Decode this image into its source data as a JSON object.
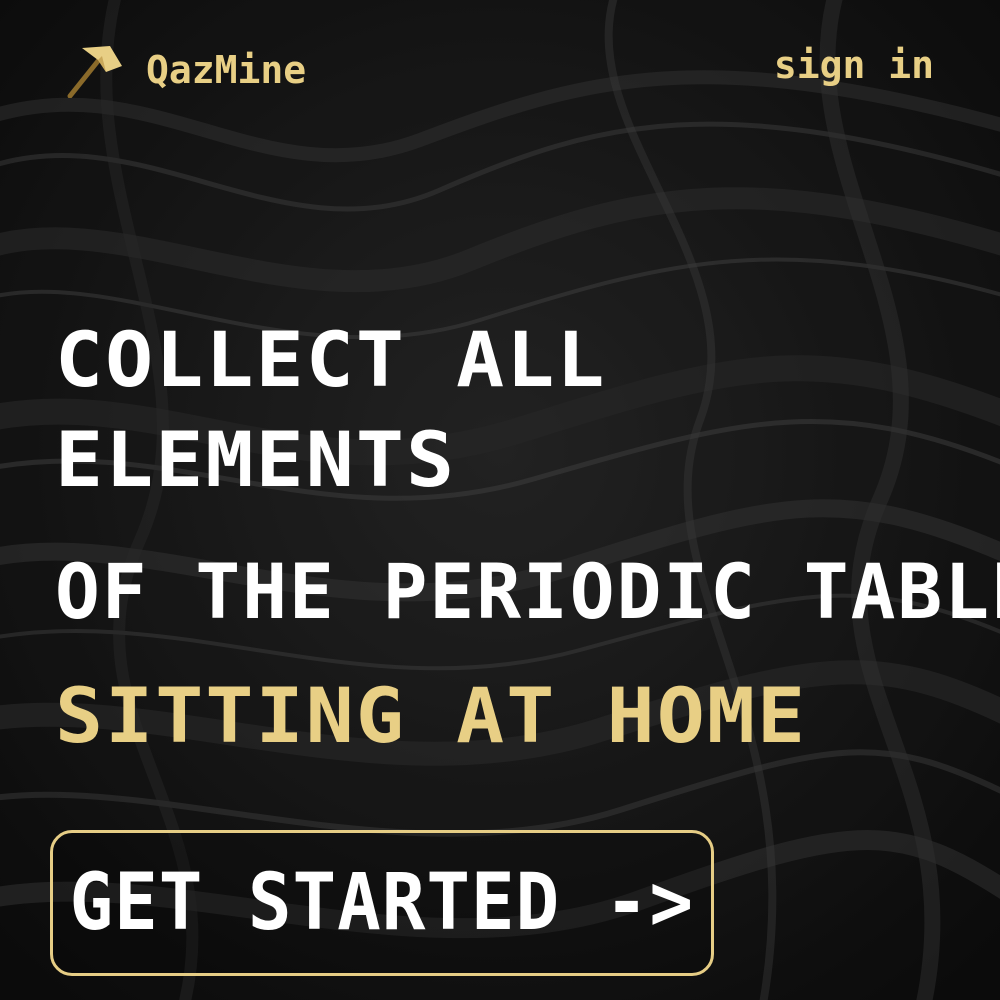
{
  "brand": {
    "name": "QazMine",
    "logo_icon": "gold-pickaxe-icon"
  },
  "nav": {
    "signin_label": "sign in"
  },
  "hero": {
    "line1": "COLLECT ALL",
    "line2": "ELEMENTS",
    "line3": "OF THE PERIODIC TABLE",
    "line4": "SITTING AT HOME"
  },
  "cta": {
    "label": "GET STARTED ->"
  },
  "colors": {
    "background": "#161616",
    "accent_gold": "#e8cf85",
    "text_white": "#ffffff"
  }
}
